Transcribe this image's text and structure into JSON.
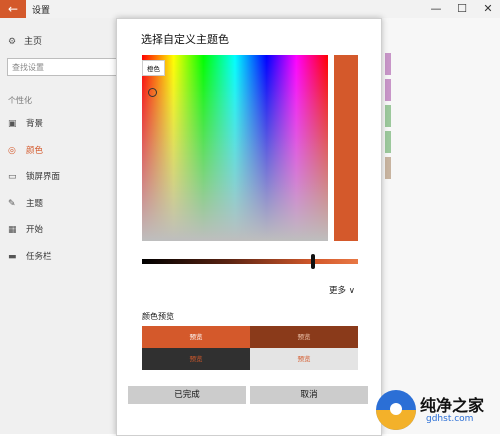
{
  "window": {
    "back_glyph": "←",
    "title": "设置",
    "minimize_glyph": "—",
    "maximize_glyph": "☐",
    "close_glyph": "✕"
  },
  "sidebar": {
    "home_label": "主页",
    "home_icon": "gear-icon",
    "search_placeholder": "查找设置",
    "section_label": "个性化",
    "items": [
      {
        "label": "背景",
        "icon": "image-icon",
        "glyph": "▣",
        "active": false
      },
      {
        "label": "颜色",
        "icon": "palette-icon",
        "glyph": "◎",
        "active": true
      },
      {
        "label": "锁屏界面",
        "icon": "lock-screen-icon",
        "glyph": "▭",
        "active": false
      },
      {
        "label": "主题",
        "icon": "brush-icon",
        "glyph": "✎",
        "active": false
      },
      {
        "label": "开始",
        "icon": "start-icon",
        "glyph": "▦",
        "active": false
      },
      {
        "label": "任务栏",
        "icon": "taskbar-icon",
        "glyph": "▬",
        "active": false
      }
    ],
    "active_color": "#d4592b"
  },
  "background_swatches": [
    "#c896c8",
    "#c896c8",
    "#9cc89c",
    "#9cc89c",
    "#c8b4a0"
  ],
  "dialog": {
    "title": "选择自定义主题色",
    "picker_tooltip": "橙色",
    "selected_color": "#d4592b",
    "brightness_level": 0.79,
    "more_label": "更多 ∨",
    "preview_label": "颜色预览",
    "preview_cells": [
      {
        "text": "预览",
        "bg": "#d4592b",
        "fg": "#ffffff"
      },
      {
        "text": "预览",
        "bg": "#8a3a1a",
        "fg": "#f0c8b0"
      },
      {
        "text": "预览",
        "bg": "#303030",
        "fg": "#d4592b"
      },
      {
        "text": "预览",
        "bg": "#e4e4e4",
        "fg": "#d4592b"
      }
    ],
    "done_label": "已完成",
    "cancel_label": "取消"
  },
  "watermark": {
    "name": "纯净之家",
    "url": "gdhst.com"
  }
}
